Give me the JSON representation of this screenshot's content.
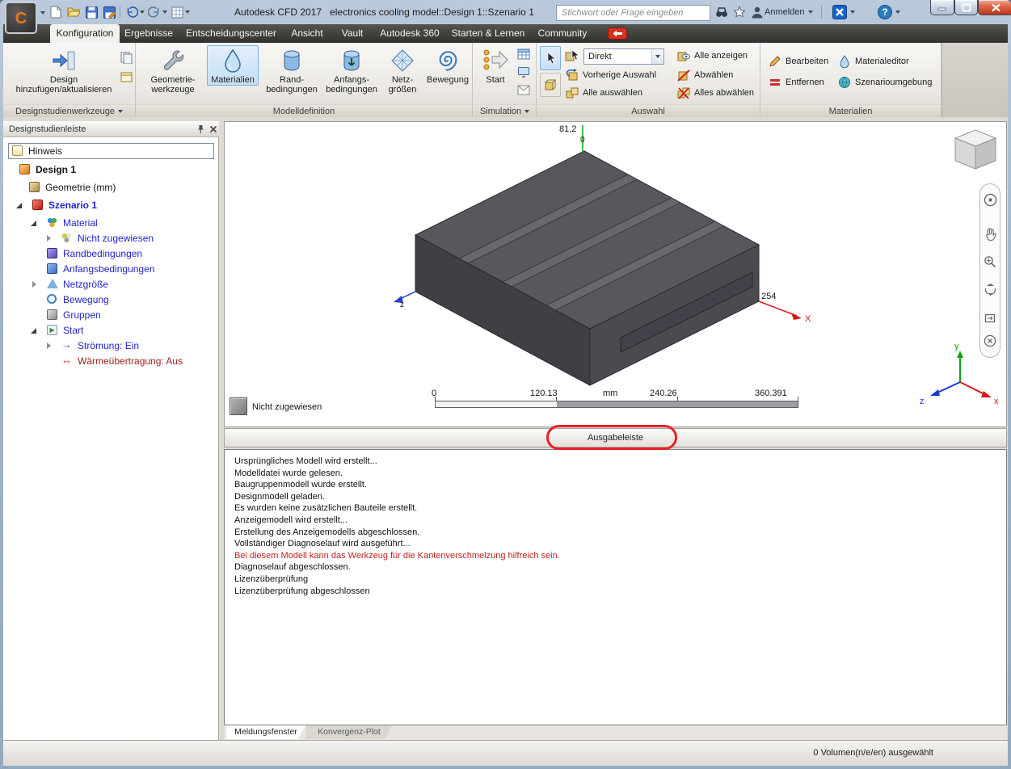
{
  "titlebar": {
    "app_title": "Autodesk CFD 2017   electronics cooling model::Design 1::Szenario 1",
    "search_placeholder": "Stichwort oder Frage eingeben",
    "signin_label": "Anmelden"
  },
  "menu": {
    "tabs": [
      {
        "label": "Konfiguration",
        "active": true
      },
      {
        "label": "Ergebnisse",
        "active": false
      },
      {
        "label": "Entscheidungscenter",
        "active": false
      },
      {
        "label": "Ansicht",
        "active": false
      },
      {
        "label": "Vault",
        "active": false
      },
      {
        "label": "Autodesk 360",
        "active": false
      },
      {
        "label": "Starten & Lernen",
        "active": false
      },
      {
        "label": "Community",
        "active": false
      }
    ]
  },
  "ribbon": {
    "design_tools": {
      "label": "Designstudienwerkzeuge",
      "button_l1": "Design",
      "button_l2": "hinzufügen/aktualisieren"
    },
    "model_definition": {
      "label": "Modelldefinition",
      "buttons": [
        {
          "l1": "Geometrie-",
          "l2": "werkzeuge",
          "selected": false
        },
        {
          "l1": "Materialien",
          "l2": "",
          "selected": true
        },
        {
          "l1": "Rand-",
          "l2": "bedingungen",
          "selected": false
        },
        {
          "l1": "Anfangs-",
          "l2": "bedingungen",
          "selected": false
        },
        {
          "l1": "Netz-",
          "l2": "größen",
          "selected": false
        },
        {
          "l1": "Bewegung",
          "l2": "",
          "selected": false
        }
      ]
    },
    "simulation": {
      "label": "Simulation",
      "start_label": "Start"
    },
    "selection": {
      "label": "Auswahl",
      "mode_value": "Direkt",
      "previous_label": "Vorherige Auswahl",
      "select_all_label": "Alle auswählen",
      "show_all_label": "Alle anzeigen",
      "deselect_label": "Abwählen",
      "deselect_all_label": "Alles abwählen"
    },
    "materials": {
      "label": "Materialien",
      "edit_label": "Bearbeiten",
      "remove_label": "Entfernen",
      "editor_label": "Materialeditor",
      "environment_label": "Szenarioumgebung"
    }
  },
  "sidebar": {
    "title": "Designstudienleiste",
    "note_item": "Hinweis",
    "tree": [
      {
        "label": "Design 1"
      },
      {
        "label": "Geometrie (mm)"
      },
      {
        "label": "Szenario 1"
      },
      {
        "label": "Material"
      },
      {
        "label": "Nicht zugewiesen"
      },
      {
        "label": "Randbedingungen"
      },
      {
        "label": "Anfangsbedingungen"
      },
      {
        "label": "Netzgröße"
      },
      {
        "label": "Bewegung"
      },
      {
        "label": "Gruppen"
      },
      {
        "label": "Start"
      },
      {
        "label": "Strömung: Ein"
      },
      {
        "label": "Wärmeübertragung: Aus"
      }
    ]
  },
  "viewport": {
    "dim_height": "81,2",
    "dim_origin": "0",
    "dim_depth": "254",
    "axis_x": "X",
    "axis_z": "z",
    "ruler": {
      "t0": "0",
      "t1": "120.13",
      "unit": "mm",
      "t2": "240.26",
      "t3": "360.391"
    },
    "legend_label": "Nicht zugewiesen",
    "triad": {
      "x": "x",
      "y": "y",
      "z": "z"
    }
  },
  "output": {
    "bar_label": "Ausgabeleiste",
    "messages": [
      "Ursprüngliches Modell wird erstellt...",
      "Modelldatei wurde gelesen.",
      "Baugruppenmodell wurde erstellt.",
      "Designmodell geladen.",
      "Es wurden keine zusätzlichen Bauteile erstellt.",
      "Anzeigemodell wird erstellt...",
      "Erstellung des Anzeigemodells abgeschlossen.",
      "Vollständiger Diagnoselauf wird ausgeführt...",
      "Bei diesem Modell kann das Werkzeug für die Kantenverschmelzung hilfreich sein.",
      "Diagnoselauf abgeschlossen.",
      "Lizenzüberprüfung",
      "Lizenzüberprüfung abgeschlossen"
    ],
    "tabs": [
      {
        "label": "Meldungsfenster",
        "active": true
      },
      {
        "label": "Konvergenz-Plot",
        "active": false
      }
    ]
  },
  "statusbar": {
    "selection_info": "0 Volumen(n/e/en) ausgewählt"
  },
  "colors": {
    "selected_button_bg": "#cfe3f6",
    "annotation_red": "#e8202a",
    "tree_link_blue": "#1f1fd0",
    "warning_text_red": "#c22222",
    "model_gray": "#4a4a50",
    "axis_x_red": "#e01818",
    "axis_y_green": "#18a018",
    "axis_z_blue": "#2840cc"
  },
  "icons": [
    "app-logo",
    "new-file-icon",
    "open-file-icon",
    "save-icon",
    "save-as-icon",
    "undo-icon",
    "redo-icon",
    "capture-icon",
    "search-binoculars-icon",
    "favorites-star-icon",
    "user-icon",
    "exchange-apps-icon",
    "help-icon",
    "minimize-icon",
    "maximize-icon",
    "close-icon",
    "community-sync-icon",
    "design-add-icon",
    "geometry-tools-icon",
    "materials-drop-icon",
    "boundary-conditions-icon",
    "initial-conditions-icon",
    "mesh-sizes-icon",
    "motion-icon",
    "start-icon",
    "solution-table-icon",
    "monitor-icon",
    "email-icon",
    "cursor-select-icon",
    "box-select-icon",
    "direct-select-icon",
    "previous-selection-icon",
    "select-all-icon",
    "show-all-icon",
    "deselect-icon",
    "deselect-all-icon",
    "edit-pencil-icon",
    "remove-icon",
    "material-editor-icon",
    "scenario-environment-icon",
    "pin-icon",
    "close-panel-icon",
    "note-icon",
    "design-icon",
    "geometry-icon",
    "scenario-icon",
    "material-icon",
    "material-unassigned-icon",
    "mesh-icon",
    "groups-icon",
    "flow-icon",
    "heat-transfer-icon",
    "view-cube",
    "nav-wheel-icon",
    "pan-hand-icon",
    "zoom-icon",
    "orbit-icon",
    "look-icon",
    "close-nav-icon",
    "axis-triad"
  ]
}
